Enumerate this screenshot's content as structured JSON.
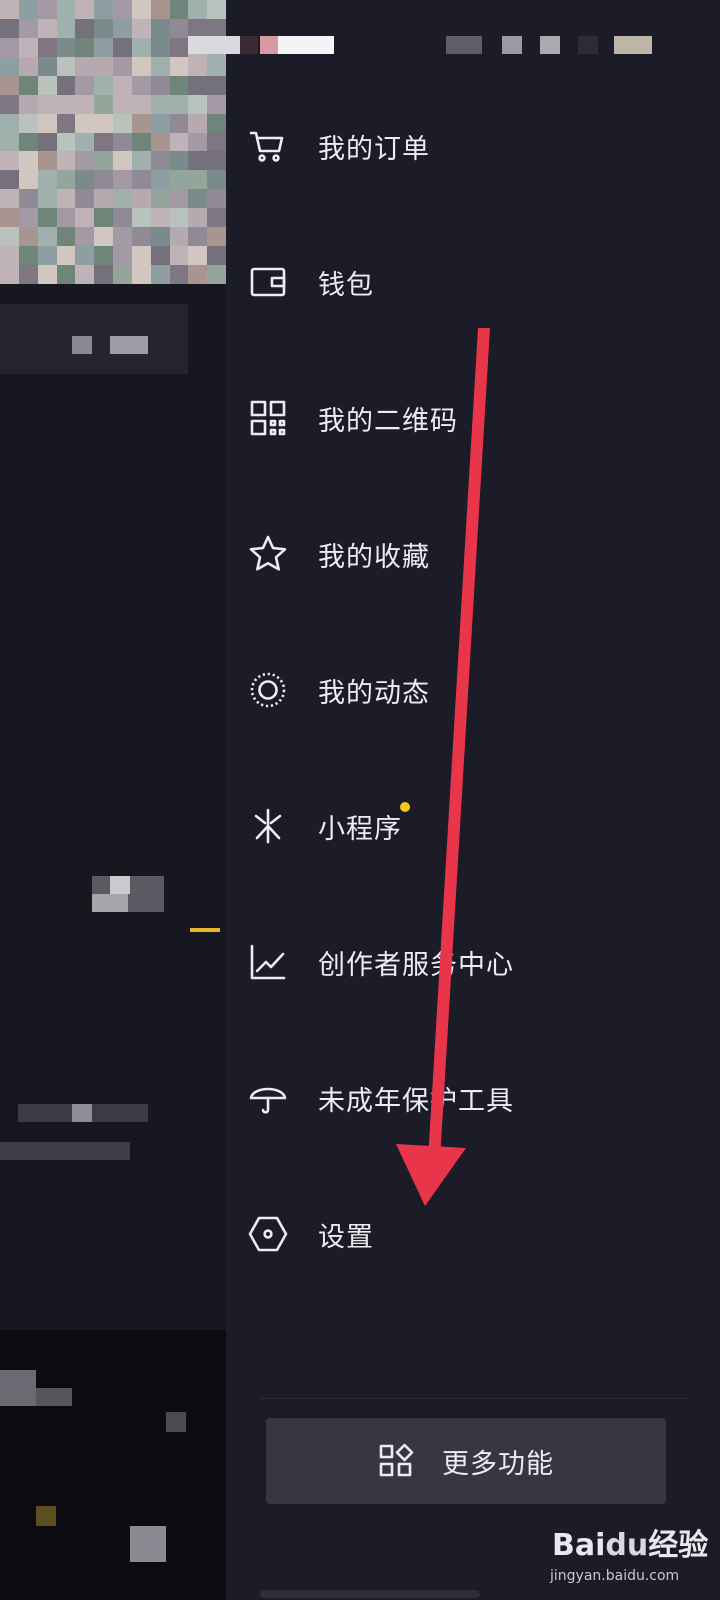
{
  "menu": {
    "items": [
      {
        "label": "我的订单",
        "icon": "shopping-cart-icon"
      },
      {
        "label": "钱包",
        "icon": "wallet-icon"
      },
      {
        "label": "我的二维码",
        "icon": "qr-code-icon"
      },
      {
        "label": "我的收藏",
        "icon": "star-icon"
      },
      {
        "label": "我的动态",
        "icon": "dynamic-circle-icon"
      },
      {
        "label": "小程序",
        "icon": "mini-program-icon",
        "badge_dot": true
      },
      {
        "label": "创作者服务中心",
        "icon": "chart-line-icon"
      },
      {
        "label": "未成年保护工具",
        "icon": "umbrella-icon"
      },
      {
        "label": "设置",
        "icon": "settings-hexagon-icon"
      }
    ]
  },
  "more_button": {
    "label": "更多功能",
    "icon": "more-grid-icon"
  },
  "watermark": {
    "logo_text": "Bai",
    "logo_du": "du",
    "logo_suffix": "经验",
    "url": "jingyan.baidu.com"
  },
  "colors": {
    "drawer_bg": "#1b1c27",
    "page_bg": "#16171f",
    "text": "#ebedf1",
    "badge_dot": "#f7c81b",
    "annotation_arrow": "#e8354a",
    "more_button_bg": "#363742"
  }
}
